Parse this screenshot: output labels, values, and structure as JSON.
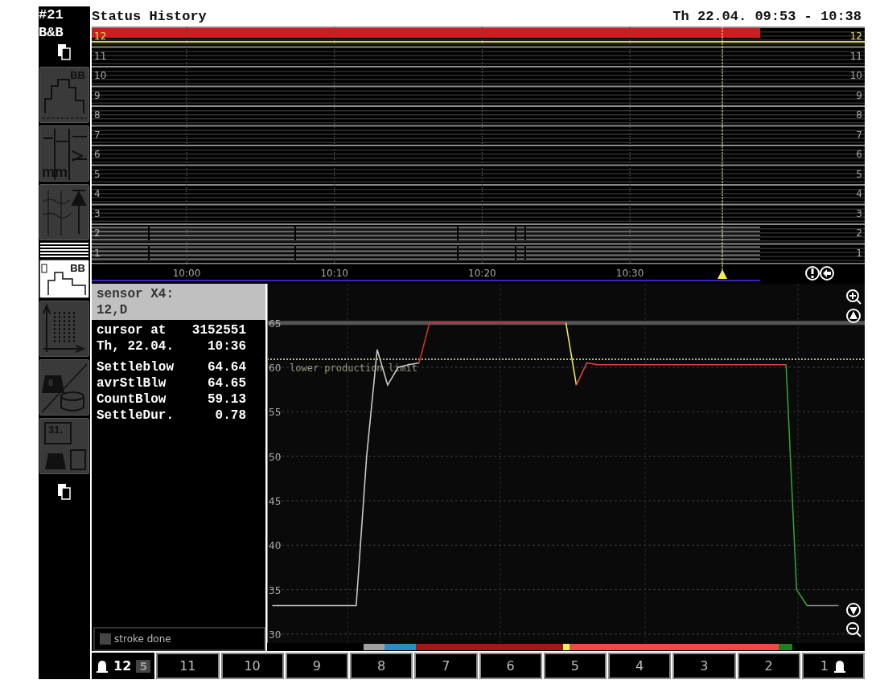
{
  "header": {
    "station": "#21",
    "machine": "B&B",
    "title": "Status History",
    "range": "Th 22.04. 09:53 - 10:38"
  },
  "sidebar": {
    "tiles": [
      {
        "kind": "profile",
        "label": "BB",
        "selected": false
      },
      {
        "kind": "measure",
        "label": "mm",
        "selected": false
      },
      {
        "kind": "trend",
        "selected": false
      },
      {
        "kind": "status",
        "label": "BB",
        "selected": true
      },
      {
        "kind": "scatter",
        "selected": false
      },
      {
        "kind": "weight",
        "label": "8",
        "selected": false
      },
      {
        "kind": "calendar",
        "label": "31.",
        "selected": false
      }
    ]
  },
  "status_chart": {
    "lanes": [
      {
        "left_label": "12",
        "right_label": "12",
        "kind": "alarm"
      },
      {
        "left_label": "11",
        "right_label": "11",
        "kind": "empty"
      },
      {
        "left_label": "10",
        "right_label": "10",
        "kind": "empty"
      },
      {
        "left_label": "9",
        "right_label": "9",
        "kind": "empty"
      },
      {
        "left_label": "8",
        "right_label": "8",
        "kind": "empty"
      },
      {
        "left_label": "7",
        "right_label": "7",
        "kind": "empty"
      },
      {
        "left_label": "6",
        "right_label": "6",
        "kind": "empty"
      },
      {
        "left_label": "5",
        "right_label": "5",
        "kind": "empty"
      },
      {
        "left_label": "4",
        "right_label": "4",
        "kind": "empty"
      },
      {
        "left_label": "3",
        "right_label": "3",
        "kind": "empty"
      },
      {
        "left_label": "2",
        "right_label": "2",
        "kind": "trace"
      },
      {
        "left_label": "1",
        "right_label": "1",
        "kind": "trace"
      }
    ],
    "time_labels": [
      "10:00",
      "10:10",
      "10:20",
      "10:30"
    ]
  },
  "info_panel": {
    "title": "sensor X4:",
    "subtitle": "12,D",
    "rows": [
      {
        "label": "cursor at",
        "value": "3152551"
      },
      {
        "label": "Th, 22.04.",
        "value": "10:36"
      }
    ],
    "readings": [
      {
        "label": "Settleblow",
        "value": "64.64"
      },
      {
        "label": "avrStlBlw",
        "value": "64.65"
      },
      {
        "label": "CountBlow",
        "value": "59.13"
      },
      {
        "label": "SettleDur.",
        "value": "0.78"
      }
    ],
    "stroke_done": {
      "label": "stroke done",
      "checked": false
    }
  },
  "trend_chart": {
    "chart_data": {
      "type": "line",
      "ylim": [
        29,
        69.4
      ],
      "yticks": [
        30,
        35,
        40,
        45,
        50,
        55,
        60,
        65
      ],
      "categories": [
        null,
        null,
        null,
        null,
        null,
        null,
        null,
        null,
        null,
        null,
        null,
        null,
        null,
        null,
        null,
        null,
        null,
        null,
        null,
        null,
        null,
        null,
        null,
        null,
        null,
        null,
        null,
        null,
        null,
        null,
        null,
        null,
        null,
        null,
        null,
        null,
        null,
        null,
        null,
        null,
        null,
        null,
        null,
        null,
        null,
        null,
        null,
        null,
        null,
        null,
        null,
        null,
        null,
        null,
        null,
        null,
        null
      ],
      "series": [
        {
          "color": "#c8c8c8",
          "values": [
            33.2,
            33.2,
            33.2,
            33.2,
            33.2,
            33.2,
            33.2,
            33.2,
            33.2,
            50,
            62,
            58,
            60,
            60.3,
            60.5,
            null,
            null,
            null,
            null,
            null,
            null,
            null,
            null,
            null,
            null,
            null,
            null,
            null,
            null,
            null,
            null,
            null,
            null,
            null,
            null,
            null,
            null,
            null,
            null,
            null,
            null,
            null,
            null,
            null,
            null,
            null,
            null,
            null,
            null,
            null,
            null,
            null,
            null,
            null,
            null,
            null,
            null
          ]
        },
        {
          "color": "#d03030",
          "values": [
            null,
            null,
            null,
            null,
            null,
            null,
            null,
            null,
            null,
            null,
            null,
            null,
            null,
            null,
            60.5,
            65,
            65,
            65,
            65,
            65,
            65,
            65,
            65,
            65,
            65,
            65,
            65,
            65,
            65,
            null,
            null,
            null,
            null,
            null,
            null,
            null,
            null,
            null,
            null,
            null,
            null,
            null,
            null,
            null,
            null,
            null,
            null,
            null,
            null,
            null,
            null,
            null,
            null,
            null,
            null,
            null,
            null
          ]
        },
        {
          "color": "#e8e860",
          "values": [
            null,
            null,
            null,
            null,
            null,
            null,
            null,
            null,
            null,
            null,
            null,
            null,
            null,
            null,
            null,
            null,
            null,
            null,
            null,
            null,
            null,
            null,
            null,
            null,
            null,
            null,
            null,
            null,
            65,
            58,
            null,
            null,
            null,
            null,
            null,
            null,
            null,
            null,
            null,
            null,
            null,
            null,
            null,
            null,
            null,
            null,
            null,
            null,
            null,
            null,
            null,
            null,
            null,
            null,
            null,
            null,
            null
          ]
        },
        {
          "color": "#e04040",
          "values": [
            null,
            null,
            null,
            null,
            null,
            null,
            null,
            null,
            null,
            null,
            null,
            null,
            null,
            null,
            null,
            null,
            null,
            null,
            null,
            null,
            null,
            null,
            null,
            null,
            null,
            null,
            null,
            null,
            null,
            58,
            60.5,
            60.3,
            60.3,
            60.3,
            60.3,
            60.3,
            60.3,
            60.3,
            60.3,
            60.3,
            60.3,
            60.3,
            60.3,
            60.3,
            60.3,
            60.3,
            60.3,
            60.3,
            60.3,
            60.3,
            null,
            null,
            null,
            null,
            null,
            null,
            null
          ]
        },
        {
          "color": "#30a030",
          "values": [
            null,
            null,
            null,
            null,
            null,
            null,
            null,
            null,
            null,
            null,
            null,
            null,
            null,
            null,
            null,
            null,
            null,
            null,
            null,
            null,
            null,
            null,
            null,
            null,
            null,
            null,
            null,
            null,
            null,
            null,
            null,
            null,
            null,
            null,
            null,
            null,
            null,
            null,
            null,
            null,
            null,
            null,
            null,
            null,
            null,
            null,
            null,
            null,
            null,
            60.3,
            35,
            33.2,
            null,
            null,
            null,
            null,
            null
          ]
        },
        {
          "color": "#909090",
          "values": [
            null,
            null,
            null,
            null,
            null,
            null,
            null,
            null,
            null,
            null,
            null,
            null,
            null,
            null,
            null,
            null,
            null,
            null,
            null,
            null,
            null,
            null,
            null,
            null,
            null,
            null,
            null,
            null,
            null,
            null,
            null,
            null,
            null,
            null,
            null,
            null,
            null,
            null,
            null,
            null,
            null,
            null,
            null,
            null,
            null,
            null,
            null,
            null,
            null,
            null,
            null,
            33.2,
            33.2,
            33.2,
            33.2,
            null,
            null
          ]
        }
      ],
      "grid": true,
      "ref_lines": [
        {
          "axis": "y",
          "value": 65
        },
        {
          "axis": "y",
          "value": 60.9,
          "label": "lower production limit"
        }
      ]
    }
  },
  "channel_buttons": [
    {
      "label": "12",
      "selected": true,
      "bell": true,
      "badge": "5"
    },
    {
      "label": "11",
      "selected": false,
      "bell": false
    },
    {
      "label": "10",
      "selected": false,
      "bell": false
    },
    {
      "label": "9",
      "selected": false,
      "bell": false
    },
    {
      "label": "8",
      "selected": false,
      "bell": false
    },
    {
      "label": "7",
      "selected": false,
      "bell": false
    },
    {
      "label": "6",
      "selected": false,
      "bell": false
    },
    {
      "label": "5",
      "selected": false,
      "bell": false
    },
    {
      "label": "4",
      "selected": false,
      "bell": false
    },
    {
      "label": "3",
      "selected": false,
      "bell": false
    },
    {
      "label": "2",
      "selected": false,
      "bell": false
    },
    {
      "label": "1",
      "selected": false,
      "bell": true
    }
  ]
}
